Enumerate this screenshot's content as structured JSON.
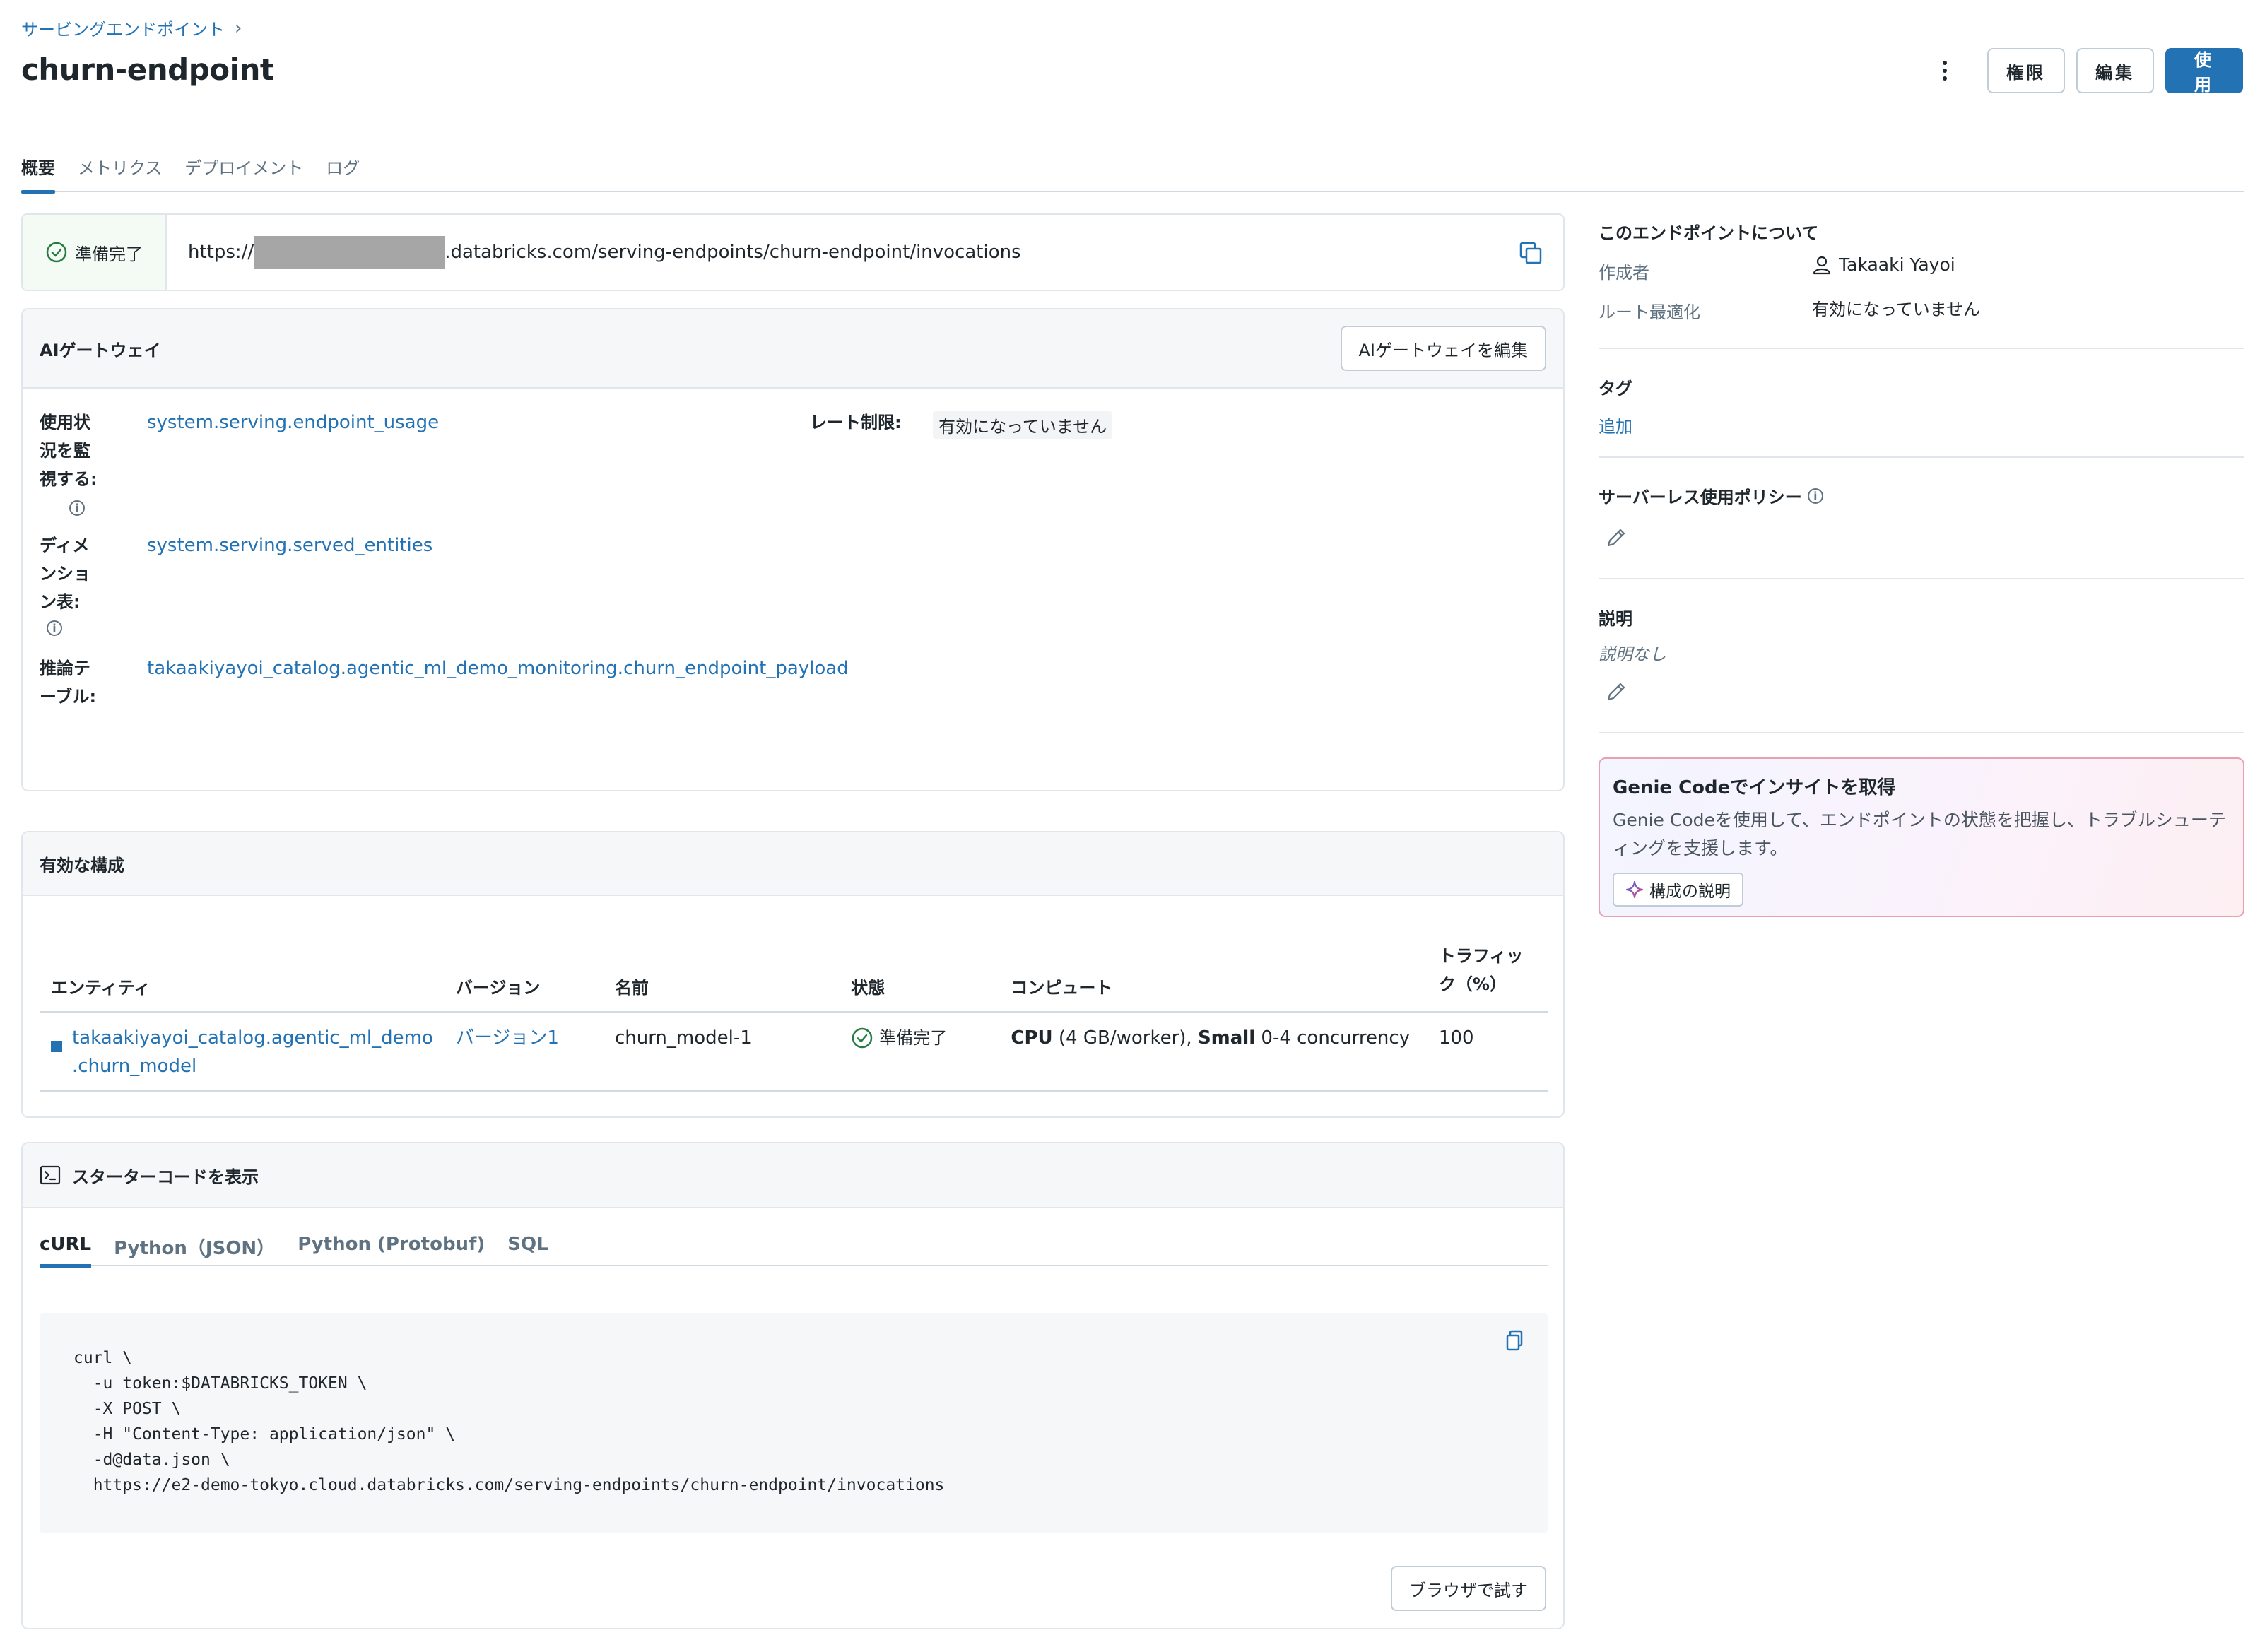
{
  "breadcrumb": {
    "parent": "サービングエンドポイント",
    "separator": "›"
  },
  "title": "churn-endpoint",
  "header_actions": {
    "permissions": "権限",
    "edit": "編集",
    "use": "使用"
  },
  "tabs": [
    {
      "label": "概要",
      "active": true
    },
    {
      "label": "メトリクス",
      "active": false
    },
    {
      "label": "デプロイメント",
      "active": false
    },
    {
      "label": "ログ",
      "active": false
    }
  ],
  "url_bar": {
    "status": "準備完了",
    "url_prefix": "https://",
    "url_suffix": ".databricks.com/serving-endpoints/churn-endpoint/invocations"
  },
  "ai_gateway": {
    "title": "AIゲートウェイ",
    "edit_button": "AIゲートウェイを編集",
    "usage_label": "使用状況を監視する:",
    "usage_value": "system.serving.endpoint_usage",
    "rate_label": "レート制限:",
    "rate_value": "有効になっていません",
    "dimension_label": "ディメンション表:",
    "dimension_value": "system.serving.served_entities",
    "inference_label": "推論テーブル:",
    "inference_value": "takaakiyayoi_catalog.agentic_ml_demo_monitoring.churn_endpoint_payload"
  },
  "active_config": {
    "title": "有効な構成",
    "columns": {
      "entity": "エンティティ",
      "version": "バージョン",
      "name": "名前",
      "status": "状態",
      "compute": "コンピュート",
      "traffic": "トラフィック（%）"
    },
    "rows": [
      {
        "entity_line1": "takaakiyayoi_catalog.agentic_ml_demo",
        "entity_line2": ".churn_model",
        "version": "バージョン1",
        "name": "churn_model-1",
        "status": "準備完了",
        "compute_cpu": "CPU",
        "compute_cpu_detail": " (4 GB/worker), ",
        "compute_size": "Small",
        "compute_concurrency": " 0-4 concurrency",
        "traffic": "100"
      }
    ]
  },
  "starter_code": {
    "title": "スターターコードを表示",
    "tabs": [
      {
        "label": "cURL",
        "active": true
      },
      {
        "label": "Python（JSON）",
        "active": false
      },
      {
        "label": "Python (Protobuf)",
        "active": false
      },
      {
        "label": "SQL",
        "active": false
      }
    ],
    "code": "curl \\\n  -u token:$DATABRICKS_TOKEN \\\n  -X POST \\\n  -H \"Content-Type: application/json\" \\\n  -d@data.json \\\n  https://e2-demo-tokyo.cloud.databricks.com/serving-endpoints/churn-endpoint/invocations",
    "try_button": "ブラウザで試す"
  },
  "about": {
    "title": "このエンドポイントについて",
    "creator_label": "作成者",
    "creator_value": "Takaaki Yayoi",
    "route_label": "ルート最適化",
    "route_value": "有効になっていません"
  },
  "tags": {
    "title": "タグ",
    "add": "追加"
  },
  "serverless_policy": {
    "title": "サーバーレス使用ポリシー"
  },
  "description": {
    "title": "説明",
    "empty": "説明なし"
  },
  "genie": {
    "title": "Genie Codeでインサイトを取得",
    "description": "Genie Codeを使用して、エンドポイントの状態を把握し、トラブルシューティングを支援します。",
    "button": "構成の説明"
  },
  "colors": {
    "accent": "#2272b4",
    "success": "#277c43",
    "text": "#1f272d",
    "muted": "#5f7281"
  }
}
